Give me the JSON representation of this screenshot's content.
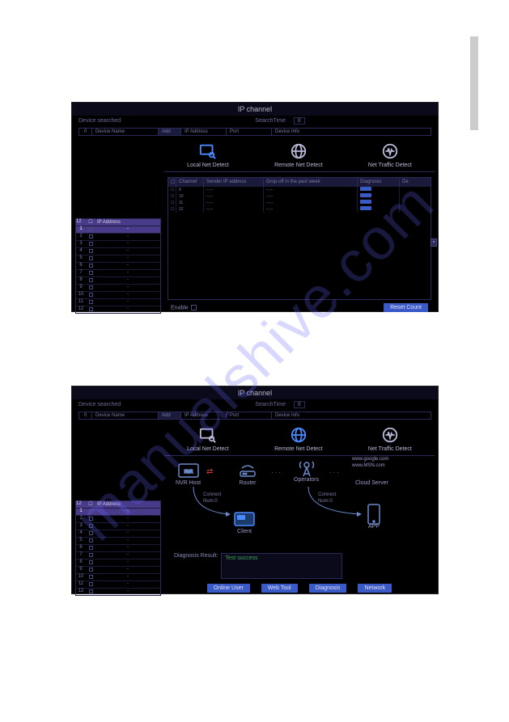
{
  "watermark": "manualshive.com",
  "screenshot1": {
    "title": "IP channel",
    "device_searched_label": "Device searched",
    "search_time_label": "SearchTime",
    "search_time_value": "8",
    "header": {
      "count": "0",
      "device_name": "Device Name",
      "add": "Add",
      "ip_address": "IP Address",
      "port": "Port",
      "device_info": "Device Info"
    },
    "detect_tabs": {
      "local": "Local Net Detect",
      "remote": "Remote Net Detect",
      "traffic": "Net Traffic Detect"
    },
    "channel_table": {
      "headers": {
        "channel": "Channel",
        "sender_ip": "Sender IP address",
        "dropoff": "Drop-off in the past week",
        "diagnosis": "Diagnosis",
        "de": "De"
      },
      "rows": [
        {
          "ch": "9",
          "ip": "--.--",
          "drop": "--.--"
        },
        {
          "ch": "10",
          "ip": "--.--",
          "drop": "--.--"
        },
        {
          "ch": "11",
          "ip": "--.--",
          "drop": "--.--"
        },
        {
          "ch": "12",
          "ip": "--.--",
          "drop": "--.--"
        }
      ]
    },
    "ip_list": {
      "count": "12",
      "header": "IP Address",
      "rows": [
        "1",
        "2",
        "3",
        "4",
        "5",
        "6",
        "7",
        "8",
        "9",
        "10",
        "11",
        "12"
      ]
    },
    "enable_label": "Enable",
    "reset_button": "Reset Count"
  },
  "screenshot2": {
    "title": "IP channel",
    "device_searched_label": "Device searched",
    "search_time_label": "SearchTime",
    "search_time_value": "8",
    "header": {
      "count": "0",
      "device_name": "Device Name",
      "add": "Add",
      "ip_address": "IP Address",
      "port": "Port",
      "device_info": "Device Info"
    },
    "detect_tabs": {
      "local": "Local Net Detect",
      "remote": "Remote Net Detect",
      "traffic": "Net Traffic Detect"
    },
    "nodes": {
      "nvr": "NVR Host",
      "router": "Router",
      "operators": "Operators",
      "cloud": "Cloud Server",
      "client": "Client",
      "app": "APP"
    },
    "connect_label": "Connect",
    "num_label": "Num:0",
    "urls": {
      "google": "www.google.com",
      "msn": "www.MSN.com"
    },
    "ip_list": {
      "count": "12",
      "header": "IP Address",
      "rows": [
        "1",
        "2",
        "3",
        "4",
        "5",
        "6",
        "7",
        "8",
        "9",
        "10",
        "11",
        "12"
      ]
    },
    "diagnosis_label": "Diagnosis Result:",
    "diagnosis_value": "Test success",
    "buttons": {
      "online_user": "Online User",
      "web_tool": "Web Tool",
      "diagnosis": "Diagnosis",
      "network": "Network"
    }
  }
}
